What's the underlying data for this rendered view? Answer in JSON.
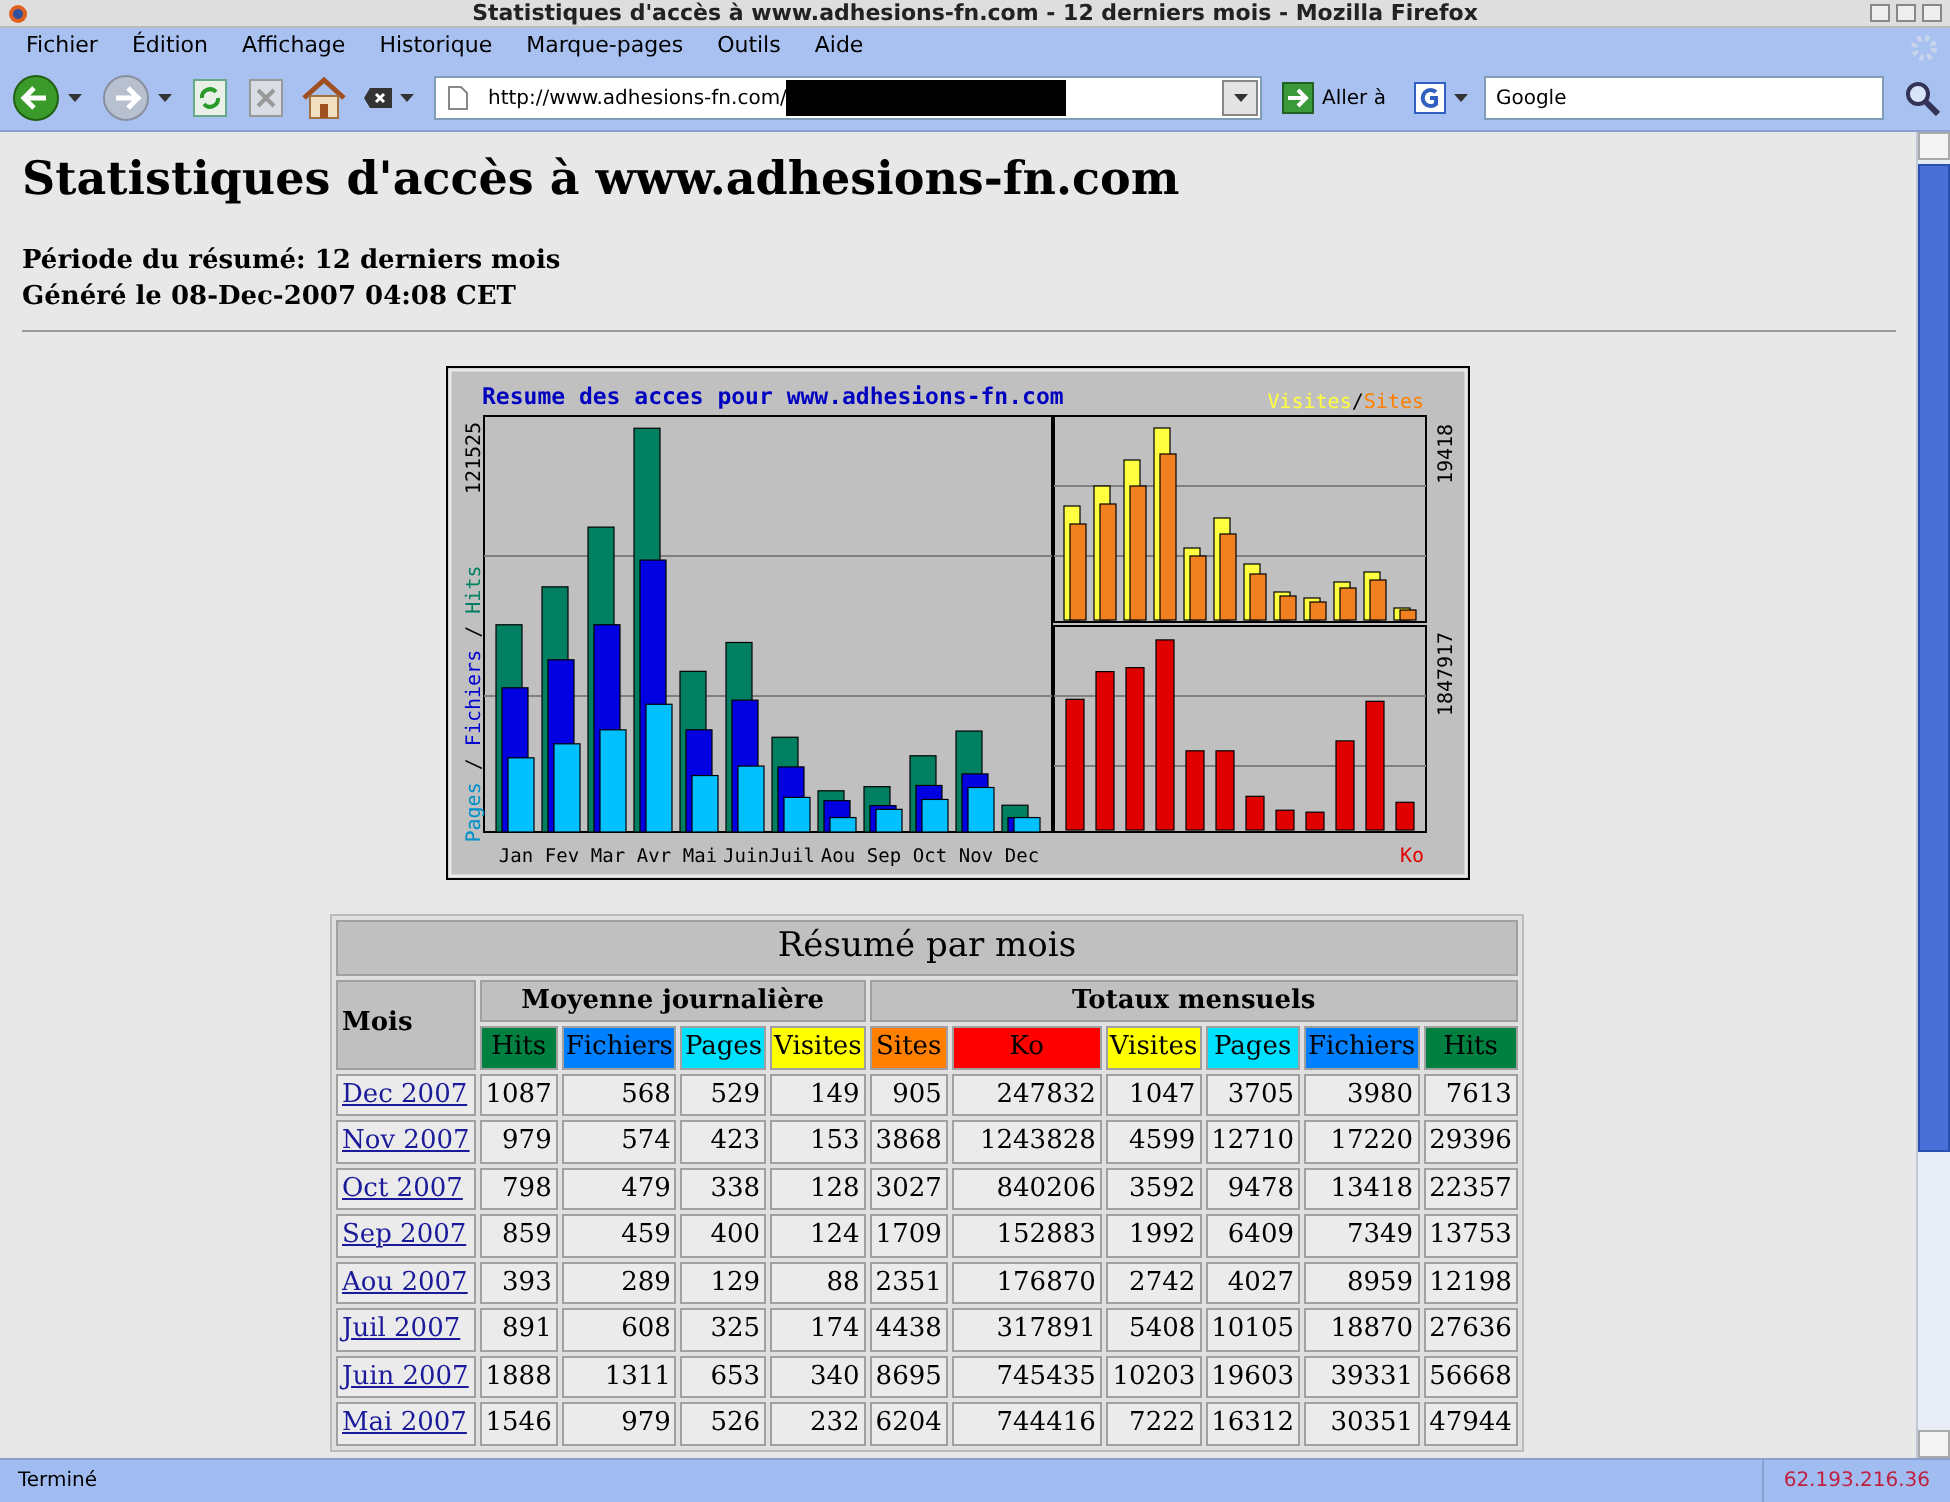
{
  "window": {
    "title": "Statistiques d'accès à www.adhesions-fn.com - 12 derniers mois - Mozilla Firefox"
  },
  "menu": [
    "Fichier",
    "Édition",
    "Affichage",
    "Historique",
    "Marque-pages",
    "Outils",
    "Aide"
  ],
  "navbar": {
    "url": "http://www.adhesions-fn.com/",
    "go_label": "Aller à",
    "search_value": "Google"
  },
  "page": {
    "heading": "Statistiques d'accès à www.adhesions-fn.com",
    "summary_lines": [
      "Période du résumé: 12 derniers mois",
      "Généré le 08-Dec-2007 04:08 CET"
    ]
  },
  "chart": {
    "title": "Resume des acces pour www.adhesions-fn.com",
    "legend": [
      {
        "label": "Visites",
        "color": "#ffff40"
      },
      {
        "label": "Sites",
        "color": "#ff8000"
      }
    ],
    "axis_label": [
      {
        "label": "Pages",
        "color": "#0090c8"
      },
      {
        "label": "Fichiers",
        "color": "#0000d0"
      },
      {
        "label": "Hits",
        "color": "#008060"
      }
    ],
    "separator": "/",
    "max_hits": "121525",
    "max_visits": "19418",
    "max_ko": "1847917",
    "ko_label": "Ko",
    "months": [
      "Jan",
      "Fev",
      "Mar",
      "Avr",
      "Mai",
      "Juin",
      "Juil",
      "Aou",
      "Sep",
      "Oct",
      "Nov",
      "Dec"
    ]
  },
  "table": {
    "title": "Résumé par mois",
    "month_header": "Mois",
    "groups": [
      "Moyenne journalière",
      "Totaux mensuels"
    ],
    "columns": [
      {
        "label": "Hits",
        "color": "#008040"
      },
      {
        "label": "Fichiers",
        "color": "#0080ff"
      },
      {
        "label": "Pages",
        "color": "#00e0ff"
      },
      {
        "label": "Visites",
        "color": "#ffff00"
      },
      {
        "label": "Sites",
        "color": "#ff8000"
      },
      {
        "label": "Ko",
        "color": "#ff0000"
      },
      {
        "label": "Visites",
        "color": "#ffff00"
      },
      {
        "label": "Pages",
        "color": "#00e0ff"
      },
      {
        "label": "Fichiers",
        "color": "#0080ff"
      },
      {
        "label": "Hits",
        "color": "#008040"
      }
    ],
    "rows": [
      {
        "month": "Dec 2007",
        "cells": [
          "1087",
          "568",
          "529",
          "149",
          "905",
          "247832",
          "1047",
          "3705",
          "3980",
          "7613"
        ]
      },
      {
        "month": "Nov 2007",
        "cells": [
          "979",
          "574",
          "423",
          "153",
          "3868",
          "1243828",
          "4599",
          "12710",
          "17220",
          "29396"
        ]
      },
      {
        "month": "Oct 2007",
        "cells": [
          "798",
          "479",
          "338",
          "128",
          "3027",
          "840206",
          "3592",
          "9478",
          "13418",
          "22357"
        ]
      },
      {
        "month": "Sep 2007",
        "cells": [
          "859",
          "459",
          "400",
          "124",
          "1709",
          "152883",
          "1992",
          "6409",
          "7349",
          "13753"
        ]
      },
      {
        "month": "Aou 2007",
        "cells": [
          "393",
          "289",
          "129",
          "88",
          "2351",
          "176870",
          "2742",
          "4027",
          "8959",
          "12198"
        ]
      },
      {
        "month": "Juil 2007",
        "cells": [
          "891",
          "608",
          "325",
          "174",
          "4438",
          "317891",
          "5408",
          "10105",
          "18870",
          "27636"
        ]
      },
      {
        "month": "Juin 2007",
        "cells": [
          "1888",
          "1311",
          "653",
          "340",
          "8695",
          "745435",
          "10203",
          "19603",
          "39331",
          "56668"
        ]
      },
      {
        "month": "Mai 2007",
        "cells": [
          "1546",
          "979",
          "526",
          "232",
          "6204",
          "744416",
          "7222",
          "16312",
          "30351",
          "47944"
        ]
      }
    ]
  },
  "status_bar": {
    "text": "Terminé",
    "ip": "62.193.216.36"
  }
}
